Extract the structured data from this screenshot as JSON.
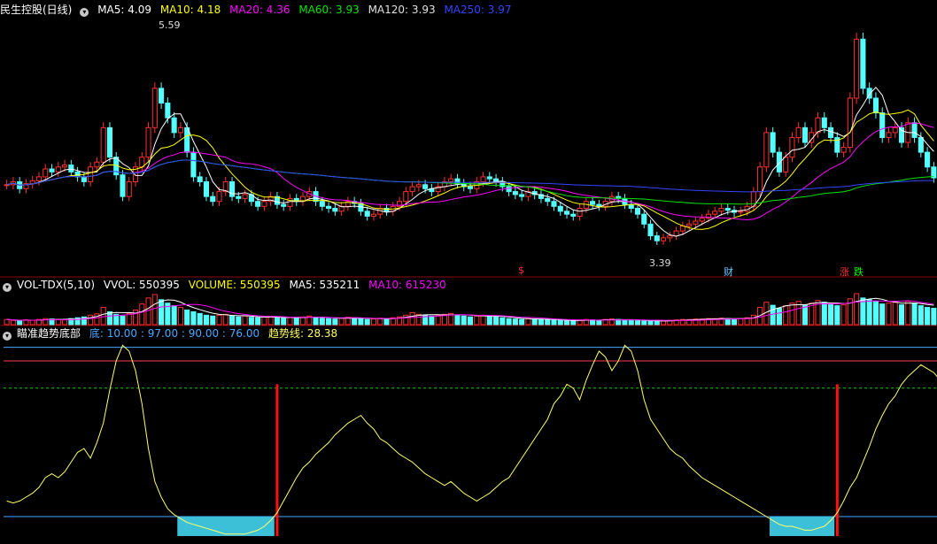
{
  "main": {
    "title": "民生控股(日线)",
    "ma": [
      {
        "label": "MA5: 4.09",
        "color": "#ffffff"
      },
      {
        "label": "MA10: 4.18",
        "color": "#ffff00"
      },
      {
        "label": "MA20: 4.36",
        "color": "#ff00ff"
      },
      {
        "label": "MA60: 3.93",
        "color": "#00e600"
      },
      {
        "label": "MA120: 3.93",
        "color": "#e0e0e0"
      },
      {
        "label": "MA250: 3.97",
        "color": "#3344ff"
      }
    ],
    "high_label": "5.59",
    "low_label": "3.39",
    "markers": [
      {
        "text": "$",
        "color": "#ff3030"
      },
      {
        "text": "财",
        "color": "#66ccff"
      },
      {
        "text": "涨",
        "color": "#ff3030"
      },
      {
        "text": "跌",
        "color": "#00ff00"
      }
    ]
  },
  "volume": {
    "title": "VOL-TDX(5,10)",
    "items": [
      {
        "label": "VVOL: 550395",
        "color": "#ffffff"
      },
      {
        "label": "VOLUME: 550395",
        "color": "#ffff00"
      },
      {
        "label": "MA5: 535211",
        "color": "#ffffff"
      },
      {
        "label": "MA10: 615230",
        "color": "#ff00ff"
      }
    ]
  },
  "indicator": {
    "title": "瞄准趋势底部",
    "items": [
      {
        "label": "底: 10.00 : 97.00 : 90.00 : 76.00",
        "color": "#4aa8ff"
      },
      {
        "label": "趋势线: 28.38",
        "color": "#ffff66"
      }
    ]
  },
  "colors": {
    "up": "#ff3030",
    "down": "#54ffff",
    "ma5": "#ffffff",
    "ma10": "#ffff00",
    "ma20": "#ff00ff",
    "ma60": "#00e600",
    "ma250": "#3344ff",
    "trend": "#ffff66",
    "bottom": "#3cc0d8"
  },
  "chart_data": [
    {
      "type": "line",
      "name": "price",
      "ylim": [
        3.2,
        5.7
      ],
      "close": [
        4.02,
        4.05,
        3.98,
        4.03,
        4.06,
        4.1,
        4.18,
        4.15,
        4.2,
        4.22,
        4.15,
        4.1,
        4.05,
        4.2,
        4.25,
        4.6,
        4.3,
        4.12,
        3.9,
        4.05,
        4.2,
        4.3,
        4.6,
        5.0,
        4.85,
        4.7,
        4.55,
        4.6,
        4.35,
        4.1,
        4.05,
        3.9,
        3.85,
        3.95,
        4.05,
        3.9,
        3.88,
        3.92,
        3.85,
        3.8,
        3.85,
        3.9,
        3.82,
        3.8,
        3.88,
        3.85,
        3.9,
        3.95,
        3.85,
        3.8,
        3.78,
        3.75,
        3.8,
        3.85,
        3.83,
        3.75,
        3.7,
        3.72,
        3.78,
        3.75,
        3.8,
        3.85,
        3.95,
        4.0,
        4.02,
        3.98,
        3.95,
        4.0,
        4.05,
        4.08,
        4.03,
        4.0,
        3.98,
        4.05,
        4.1,
        4.08,
        4.05,
        4.0,
        3.95,
        3.92,
        3.9,
        3.95,
        3.92,
        3.88,
        3.85,
        3.8,
        3.75,
        3.72,
        3.7,
        3.78,
        3.85,
        3.82,
        3.8,
        3.85,
        3.9,
        3.88,
        3.82,
        3.78,
        3.72,
        3.62,
        3.5,
        3.45,
        3.48,
        3.5,
        3.55,
        3.6,
        3.62,
        3.65,
        3.68,
        3.72,
        3.75,
        3.78,
        3.76,
        3.74,
        3.75,
        3.8,
        3.95,
        4.2,
        4.55,
        4.35,
        4.15,
        4.3,
        4.5,
        4.6,
        4.45,
        4.55,
        4.7,
        4.6,
        4.5,
        4.35,
        4.4,
        4.9,
        5.5,
        5.0,
        4.9,
        4.75,
        4.5,
        4.55,
        4.6,
        4.45,
        4.65,
        4.5,
        4.35,
        4.2,
        4.09
      ]
    },
    {
      "type": "bar",
      "name": "volume",
      "values": [
        12,
        10,
        9,
        11,
        10,
        12,
        14,
        13,
        12,
        11,
        14,
        16,
        18,
        22,
        25,
        40,
        30,
        24,
        20,
        26,
        34,
        48,
        62,
        70,
        58,
        50,
        44,
        40,
        34,
        30,
        26,
        22,
        20,
        22,
        24,
        20,
        18,
        20,
        17,
        16,
        18,
        19,
        16,
        15,
        17,
        16,
        18,
        20,
        17,
        15,
        14,
        13,
        15,
        17,
        16,
        14,
        12,
        13,
        15,
        14,
        16,
        18,
        22,
        28,
        24,
        22,
        20,
        22,
        24,
        26,
        22,
        20,
        18,
        20,
        22,
        20,
        18,
        16,
        14,
        13,
        12,
        14,
        13,
        12,
        11,
        10,
        10,
        9,
        9,
        11,
        12,
        11,
        10,
        12,
        13,
        12,
        11,
        10,
        9,
        8,
        8,
        9,
        9,
        10,
        11,
        12,
        12,
        13,
        13,
        14,
        14,
        15,
        14,
        13,
        14,
        16,
        22,
        40,
        52,
        45,
        38,
        44,
        50,
        54,
        46,
        50,
        56,
        52,
        48,
        44,
        46,
        60,
        72,
        62,
        58,
        54,
        48,
        50,
        52,
        46,
        54,
        50,
        44,
        40,
        38
      ]
    },
    {
      "type": "line",
      "name": "趋势线",
      "ylim": [
        0,
        100
      ],
      "values": [
        18,
        17,
        18,
        20,
        22,
        25,
        30,
        32,
        30,
        33,
        38,
        43,
        45,
        40,
        48,
        58,
        75,
        90,
        98,
        95,
        85,
        68,
        45,
        28,
        20,
        14,
        11,
        9,
        7,
        6,
        5,
        4,
        3,
        2,
        1,
        1,
        1,
        1,
        2,
        3,
        5,
        8,
        12,
        18,
        24,
        30,
        35,
        38,
        42,
        45,
        48,
        52,
        55,
        58,
        60,
        62,
        58,
        55,
        50,
        48,
        45,
        42,
        40,
        38,
        35,
        32,
        30,
        28,
        26,
        28,
        25,
        22,
        20,
        18,
        20,
        22,
        25,
        28,
        30,
        35,
        40,
        45,
        50,
        55,
        60,
        68,
        72,
        78,
        76,
        70,
        80,
        88,
        95,
        92,
        85,
        90,
        98,
        95,
        85,
        70,
        60,
        55,
        50,
        45,
        42,
        40,
        36,
        33,
        30,
        28,
        26,
        24,
        22,
        20,
        18,
        16,
        14,
        12,
        10,
        8,
        6,
        5,
        5,
        4,
        3,
        3,
        4,
        5,
        8,
        12,
        18,
        25,
        30,
        38,
        46,
        55,
        62,
        68,
        72,
        78,
        82,
        85,
        88,
        86,
        84,
        80,
        76,
        72,
        68
      ]
    },
    {
      "type": "bar",
      "name": "底",
      "levels": [
        10.0,
        97.0,
        90.0,
        76.0
      ]
    }
  ]
}
